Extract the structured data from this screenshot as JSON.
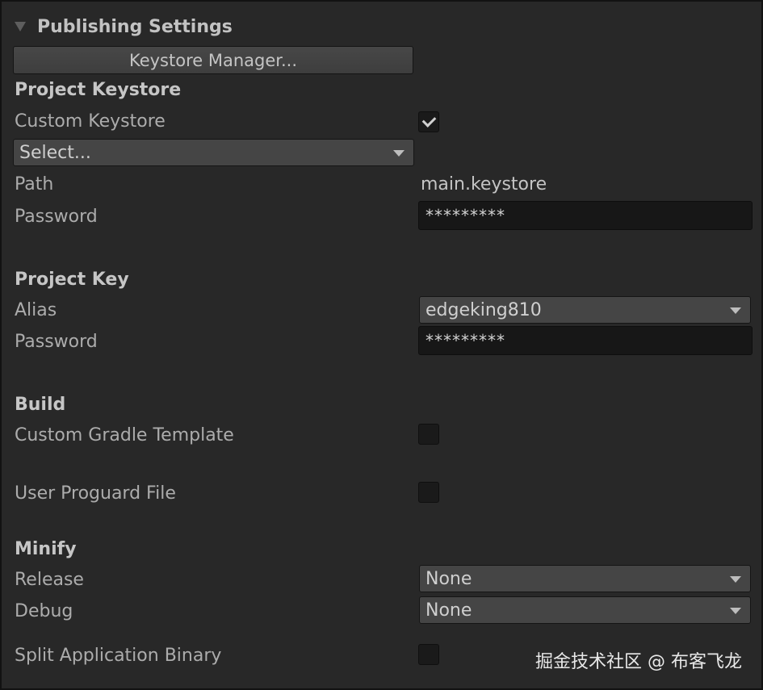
{
  "header": {
    "title": "Publishing Settings"
  },
  "keystore_manager_button": "Keystore Manager...",
  "project_keystore": {
    "section": "Project Keystore",
    "custom_keystore_label": "Custom Keystore",
    "custom_keystore_checked": true,
    "select_value": "Select...",
    "path_label": "Path",
    "path_value": "main.keystore",
    "password_label": "Password",
    "password_value": "*********"
  },
  "project_key": {
    "section": "Project Key",
    "alias_label": "Alias",
    "alias_value": "edgeking810",
    "password_label": "Password",
    "password_value": "*********"
  },
  "build": {
    "section": "Build",
    "custom_gradle_label": "Custom Gradle Template",
    "custom_gradle_checked": false,
    "user_proguard_label": "User Proguard File",
    "user_proguard_checked": false
  },
  "minify": {
    "section": "Minify",
    "release_label": "Release",
    "release_value": "None",
    "debug_label": "Debug",
    "debug_value": "None"
  },
  "split_binary": {
    "label": "Split Application Binary",
    "checked": false
  },
  "watermark": "掘金技术社区 @ 布客飞龙"
}
